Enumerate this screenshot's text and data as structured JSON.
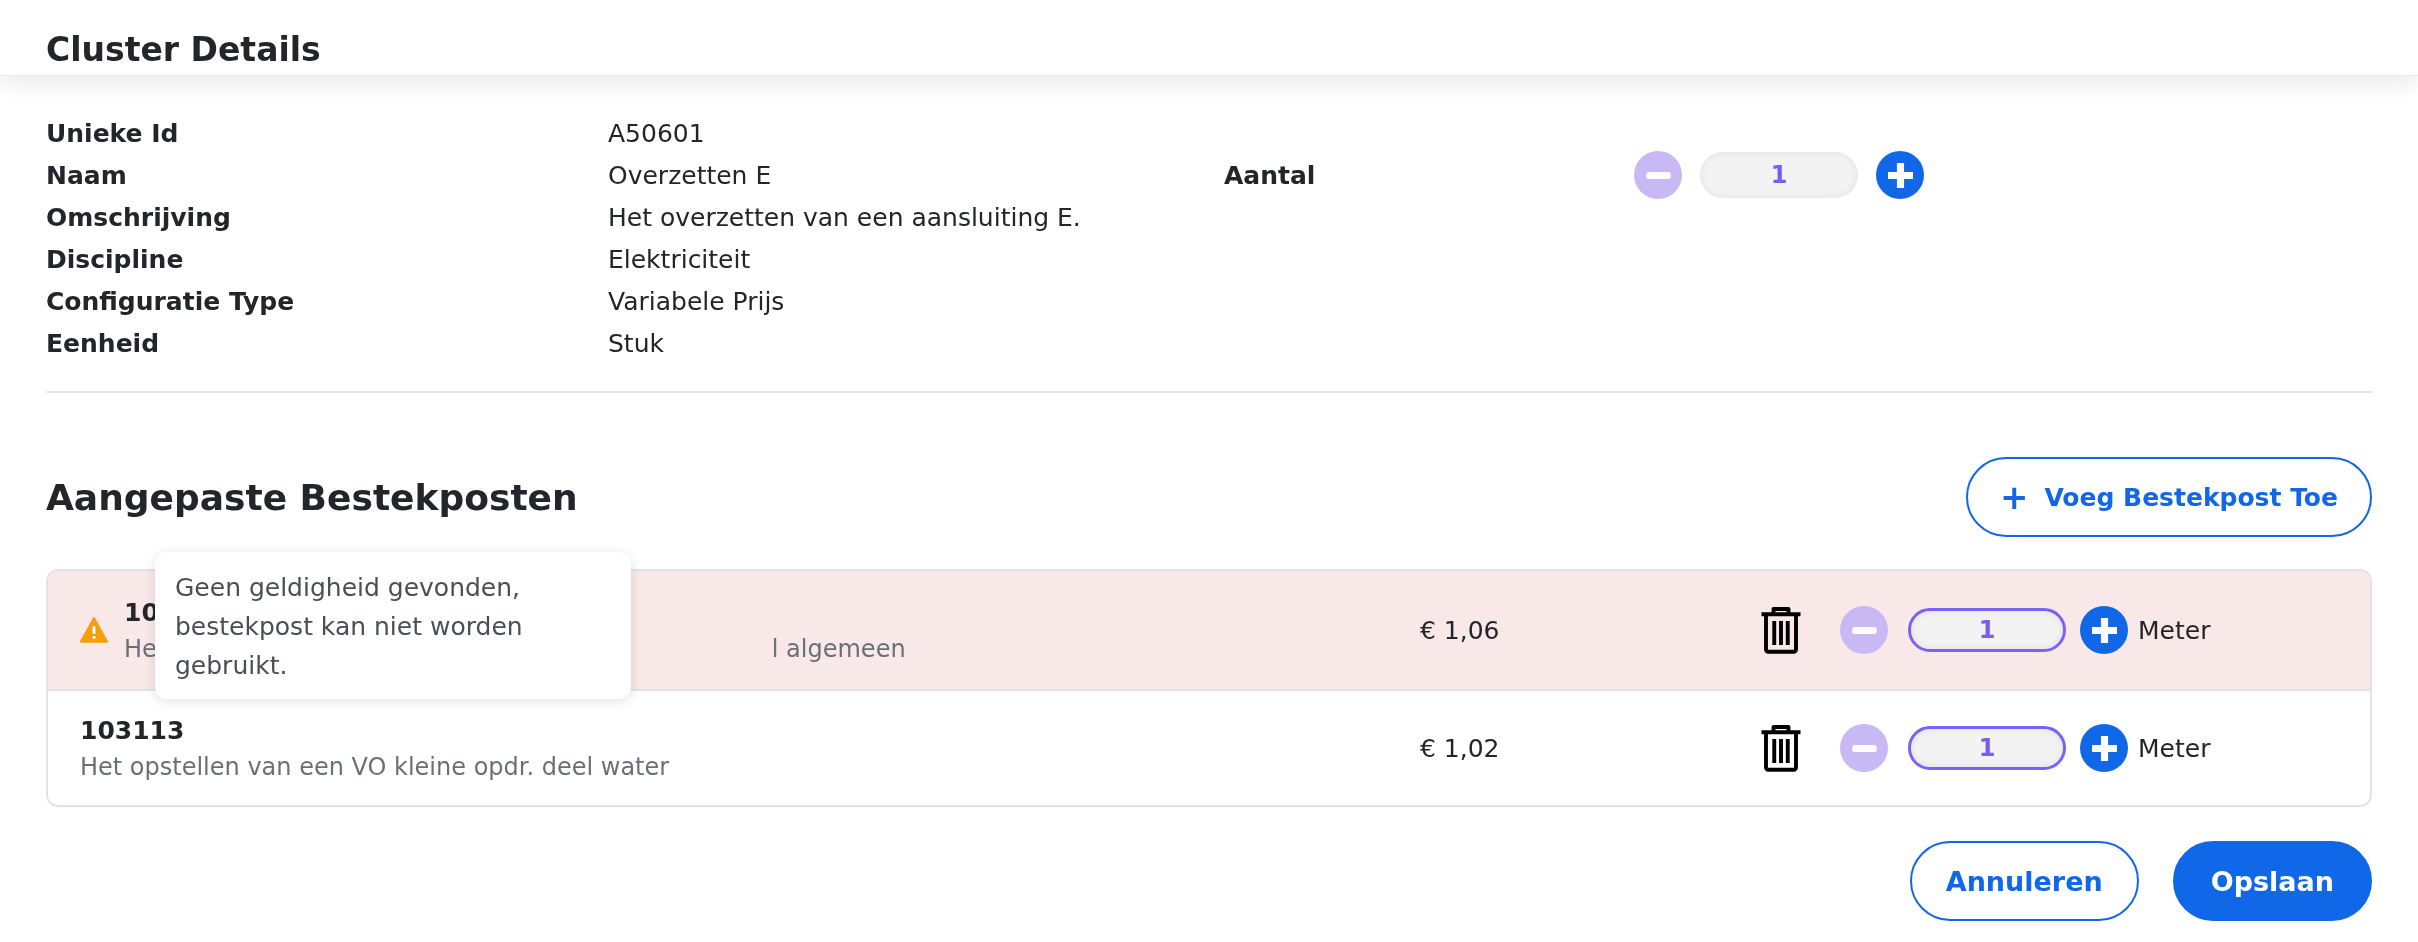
{
  "header": {
    "title": "Cluster Details"
  },
  "details": [
    {
      "label": "Unieke Id",
      "value": "A50601"
    },
    {
      "label": "Naam",
      "value": "Overzetten E"
    },
    {
      "label": "Omschrijving",
      "value": "Het overzetten van een aansluiting E."
    },
    {
      "label": "Discipline",
      "value": "Elektriciteit"
    },
    {
      "label": "Configuratie Type",
      "value": "Variabele Prijs"
    },
    {
      "label": "Eenheid",
      "value": "Stuk"
    }
  ],
  "aantal": {
    "label": "Aantal",
    "value": "1",
    "minus_disabled": true
  },
  "section": {
    "title": "Aangepaste Bestekposten",
    "add_button": {
      "icon": "+",
      "label": "Voeg Bestekpost Toe"
    }
  },
  "items": [
    {
      "code": "10",
      "description": "He",
      "description_tail": "l algemeen",
      "price": "€ 1,06",
      "quantity": "1",
      "unit": "Meter",
      "warning": true,
      "minus_disabled": true
    },
    {
      "code": "103113",
      "description": "Het opstellen van een VO kleine opdr. deel water",
      "price": "€ 1,02",
      "quantity": "1",
      "unit": "Meter",
      "warning": false,
      "minus_disabled": true
    }
  ],
  "tooltip": {
    "text": "Geen geldigheid gevonden, bestekpost kan niet worden gebruikt."
  },
  "buttons": [
    {
      "label": "Annuleren",
      "kind": "secondary"
    },
    {
      "label": "Opslaan",
      "kind": "primary"
    }
  ]
}
